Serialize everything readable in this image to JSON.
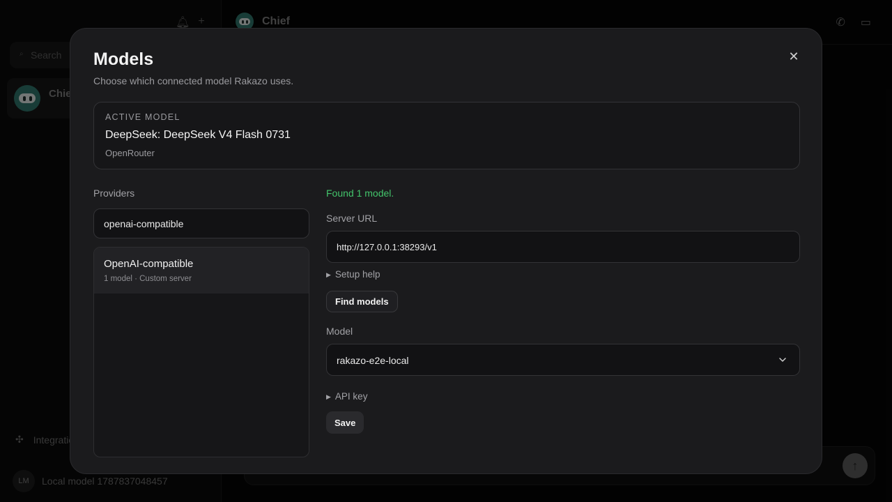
{
  "background": {
    "sidebar": {
      "search_placeholder": "Search",
      "chat_name": "Chief",
      "integrations_label": "Integrations",
      "user_initials": "LM",
      "user_name": "Local model 1787837048457"
    },
    "header": {
      "title": "Chief"
    }
  },
  "modal": {
    "title": "Models",
    "subtitle": "Choose which connected model Rakazo uses.",
    "close_glyph": "✕",
    "active": {
      "label": "ACTIVE MODEL",
      "name": "DeepSeek: DeepSeek V4 Flash 0731",
      "provider": "OpenRouter"
    },
    "providers": {
      "label": "Providers",
      "search_value": "openai-compatible",
      "items": [
        {
          "name": "OpenAI-compatible",
          "meta": "1 model · Custom server",
          "selected": true
        }
      ]
    },
    "config": {
      "status": "Found 1 model.",
      "server_url_label": "Server URL",
      "server_url_value": "http://127.0.0.1:38293/v1",
      "setup_help": "Setup help",
      "find_models": "Find models",
      "model_label": "Model",
      "model_value": "rakazo-e2e-local",
      "api_key": "API key",
      "save": "Save"
    }
  },
  "colors": {
    "status_green": "#43c46b",
    "modal_bg": "#1b1b1d",
    "avatar_teal": "#2c6e64"
  }
}
